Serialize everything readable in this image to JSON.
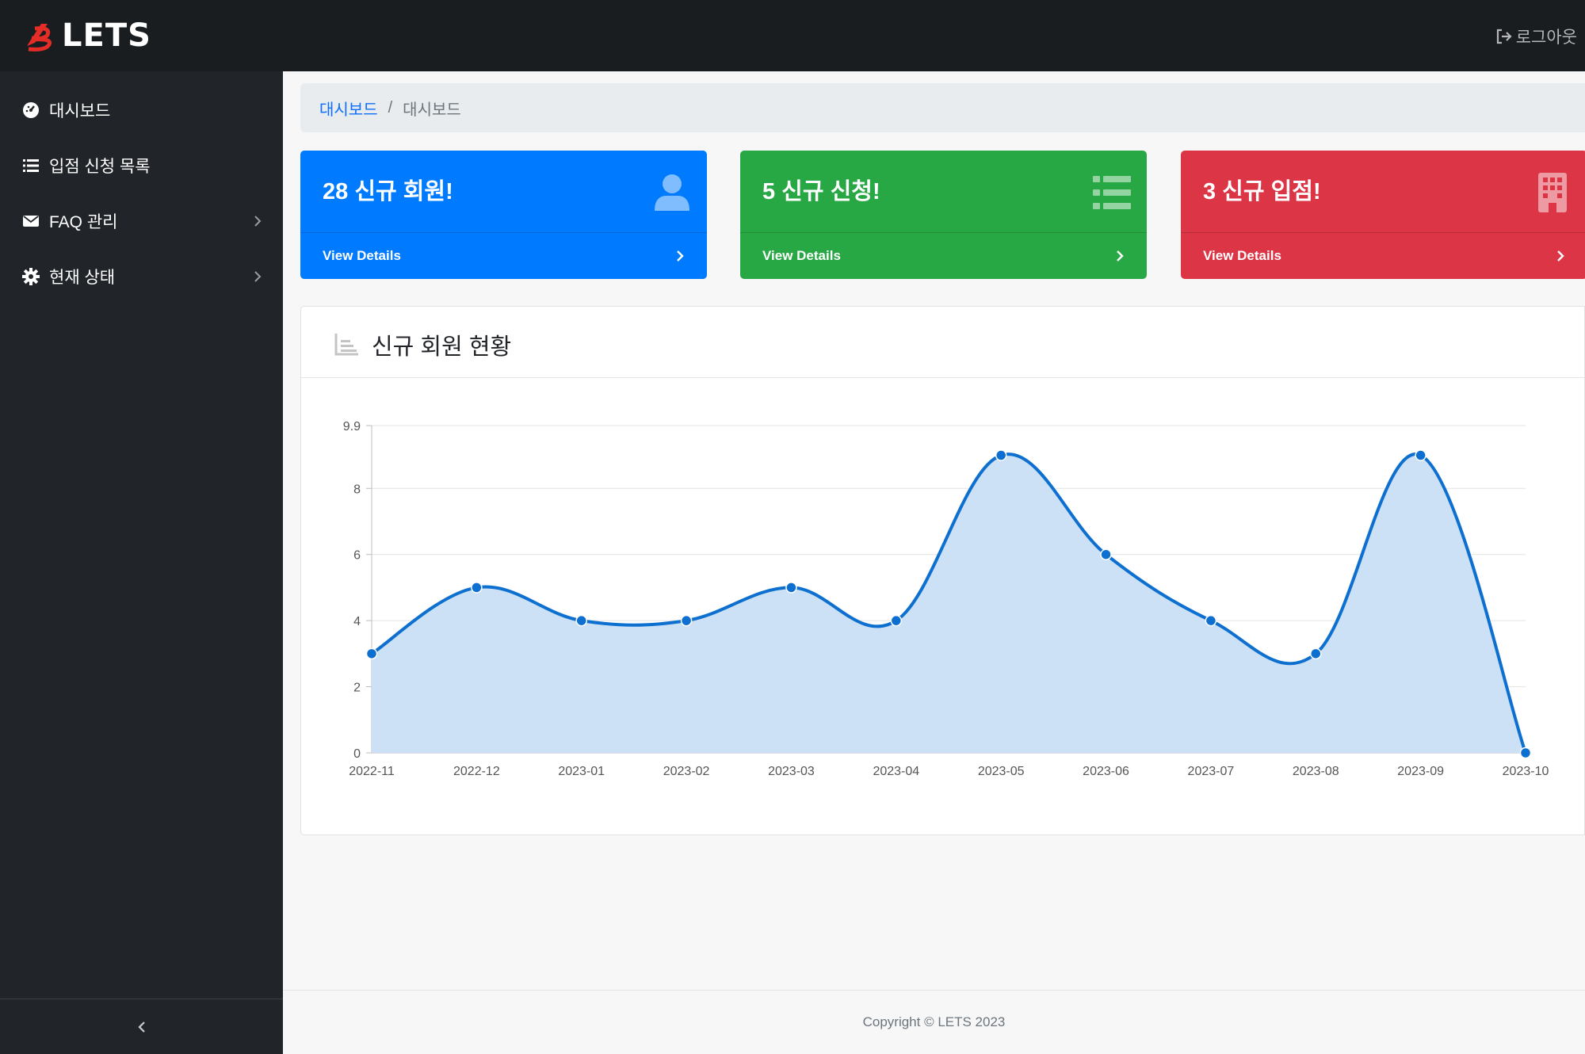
{
  "brand": {
    "name": "LETS",
    "logo_icon": "lets-logo-icon",
    "accent": "#e52d27"
  },
  "header": {
    "logout_label": "로그아웃",
    "logout_icon": "sign-out-icon"
  },
  "sidebar": {
    "items": [
      {
        "label": "대시보드",
        "icon": "tachometer-icon",
        "has_submenu": false
      },
      {
        "label": "입점 신청 목록",
        "icon": "list-icon",
        "has_submenu": false
      },
      {
        "label": "FAQ 관리",
        "icon": "envelope-icon",
        "has_submenu": true
      },
      {
        "label": "현재 상태",
        "icon": "gear-icon",
        "has_submenu": true
      }
    ],
    "collapse_icon": "chevron-left-icon"
  },
  "breadcrumb": {
    "items": [
      "대시보드",
      "대시보드"
    ],
    "separator": "/"
  },
  "cards": [
    {
      "title": "28 신규 회원!",
      "link": "View Details",
      "icon": "user-icon",
      "color": "#007bff"
    },
    {
      "title": "5 신규 신청!",
      "link": "View Details",
      "icon": "list-icon",
      "color": "#28a745"
    },
    {
      "title": "3 신규 입점!",
      "link": "View Details",
      "icon": "building-icon",
      "color": "#dc3545"
    }
  ],
  "chart_panel": {
    "title": "신규 회원 현황",
    "icon": "area-chart-icon"
  },
  "chart_data": {
    "type": "area",
    "title": "",
    "xlabel": "",
    "ylabel": "",
    "categories": [
      "2022-11",
      "2022-12",
      "2023-01",
      "2023-02",
      "2023-03",
      "2023-04",
      "2023-05",
      "2023-06",
      "2023-07",
      "2023-08",
      "2023-09",
      "2023-10"
    ],
    "values": [
      3,
      5,
      4,
      4,
      5,
      4,
      9,
      6,
      4,
      3,
      9,
      0
    ],
    "ylim": [
      0,
      9.9
    ],
    "yticks": [
      "0",
      "2",
      "4",
      "6",
      "8",
      "9.9"
    ],
    "grid": true,
    "line_color": "#0d6fcf",
    "fill_color": "#cce1f5",
    "smooth": true
  },
  "footer": {
    "copyright": "Copyright © LETS 2023"
  }
}
